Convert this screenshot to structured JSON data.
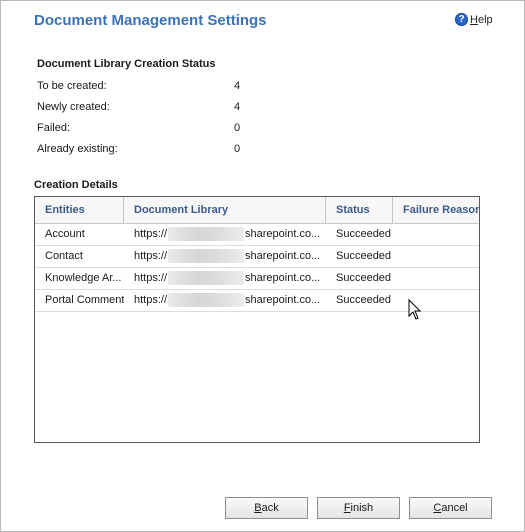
{
  "dialog": {
    "title": "Document Management Settings",
    "help_access": "H",
    "help_rest": "elp"
  },
  "status_section": {
    "title": "Document Library Creation Status",
    "stats": [
      {
        "label": "To be created:",
        "value": "4"
      },
      {
        "label": "Newly created:",
        "value": "4"
      },
      {
        "label": "Failed:",
        "value": "0"
      },
      {
        "label": "Already existing:",
        "value": "0"
      }
    ]
  },
  "details_section": {
    "title": "Creation Details",
    "columns": [
      "Entities",
      "Document Library",
      "Status",
      "Failure Reason"
    ],
    "rows": [
      {
        "entity": "Account",
        "url_prefix": "https://",
        "url_suffix": "sharepoint.co...",
        "status": "Succeeded",
        "reason": ""
      },
      {
        "entity": "Contact",
        "url_prefix": "https://",
        "url_suffix": "sharepoint.co...",
        "status": "Succeeded",
        "reason": ""
      },
      {
        "entity": "Knowledge Ar...",
        "url_prefix": "https://",
        "url_suffix": "sharepoint.co...",
        "status": "Succeeded",
        "reason": ""
      },
      {
        "entity": "Portal Comment",
        "url_prefix": "https://",
        "url_suffix": "sharepoint.co...",
        "status": "Succeeded",
        "reason": ""
      }
    ]
  },
  "buttons": {
    "back_access": "B",
    "back_rest": "ack",
    "finish_access": "F",
    "finish_rest": "inish",
    "cancel_access": "C",
    "cancel_rest": "ancel"
  },
  "icons": {
    "help": "help-icon",
    "cursor": "mouse-pointer-icon",
    "redacted": "redacted-blur"
  },
  "colors": {
    "title": "#3b73b9",
    "column_header": "#3b5a8c",
    "help_icon": "#2a66c2"
  }
}
